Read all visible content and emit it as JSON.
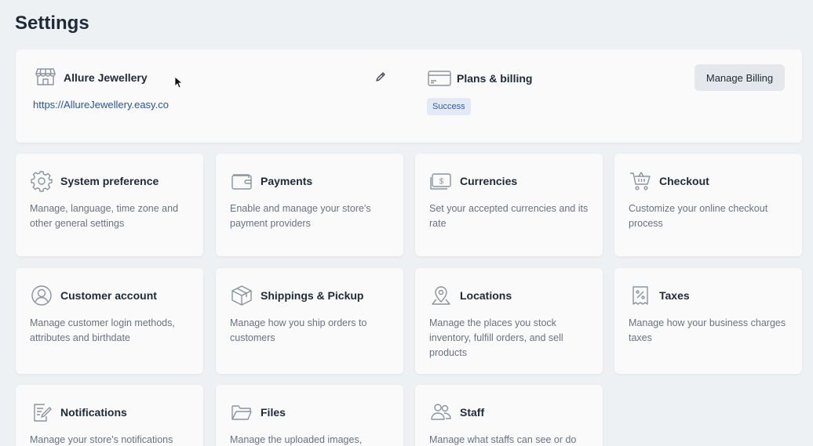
{
  "page": {
    "title": "Settings"
  },
  "store": {
    "name": "Allure Jewellery",
    "url": "https://AllureJewellery.easy.co",
    "icon": "storefront-icon"
  },
  "billing": {
    "title": "Plans & billing",
    "status": "Success",
    "button_label": "Manage Billing",
    "icon": "credit-card-icon"
  },
  "tiles": [
    {
      "title": "System preference",
      "desc": "Manage, language, time zone and other general settings",
      "icon": "gear-icon"
    },
    {
      "title": "Payments",
      "desc": "Enable and manage your store's payment providers",
      "icon": "wallet-icon"
    },
    {
      "title": "Currencies",
      "desc": "Set your accepted currencies and its rate",
      "icon": "banknote-icon"
    },
    {
      "title": "Checkout",
      "desc": "Customize your online checkout process",
      "icon": "shopping-cart-icon"
    },
    {
      "title": "Customer account",
      "desc": "Manage customer login methods, attributes and birthdate",
      "icon": "user-circle-icon"
    },
    {
      "title": "Shippings & Pickup",
      "desc": "Manage how you ship orders to customers",
      "icon": "package-icon"
    },
    {
      "title": "Locations",
      "desc": "Manage the places you stock inventory, fulfill orders, and sell products",
      "icon": "map-pin-icon"
    },
    {
      "title": "Taxes",
      "desc": "Manage how your business charges taxes",
      "icon": "receipt-percent-icon"
    },
    {
      "title": "Notifications",
      "desc": "Manage your store's notifications",
      "icon": "document-edit-icon"
    },
    {
      "title": "Files",
      "desc": "Manage the uploaded images,",
      "icon": "folder-icon"
    },
    {
      "title": "Staff",
      "desc": "Manage what staffs can see or do",
      "icon": "users-icon"
    }
  ],
  "colors": {
    "background": "#eef1f4",
    "card": "#fafafa",
    "link": "#2a52a8",
    "badge_bg": "#e3eaf5",
    "badge_text": "#2e5bb0",
    "button_bg": "#e4e7eb"
  }
}
